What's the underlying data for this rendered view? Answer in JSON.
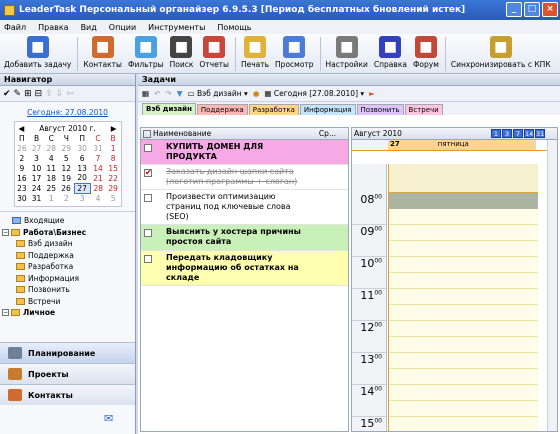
{
  "window": {
    "title": "LeaderTask Персональный органайзер 6.9.5.3 [Период бесплатных  бновлений истек]"
  },
  "menu": [
    "Файл",
    "Правка",
    "Вид",
    "Опции",
    "Инструменты",
    "Помощь"
  ],
  "toolbar": [
    {
      "label": "Добавить задачу",
      "icon": "add-task-icon",
      "color": "#3a6fd0"
    },
    {
      "label": "Контакты",
      "icon": "contacts-icon",
      "color": "#d06a30"
    },
    {
      "label": "Фильтры",
      "icon": "filter-icon",
      "color": "#4aa0e0"
    },
    {
      "label": "Поиск",
      "icon": "binoculars-icon",
      "color": "#444444"
    },
    {
      "label": "Отчеты",
      "icon": "reports-icon",
      "color": "#c9463d"
    },
    {
      "label": "Печать",
      "icon": "printer-icon",
      "color": "#e0b23a"
    },
    {
      "label": "Просмотр",
      "icon": "preview-icon",
      "color": "#4c7cd8"
    },
    {
      "label": "Настройки",
      "icon": "gear-icon",
      "color": "#7a7a7a"
    },
    {
      "label": "Справка",
      "icon": "help-icon",
      "color": "#3340c0"
    },
    {
      "label": "Форум",
      "icon": "forum-icon",
      "color": "#c04a3a"
    },
    {
      "label": "Синхронизировать с КПК",
      "icon": "sync-icon",
      "color": "#c5a030"
    }
  ],
  "navigator": {
    "title": "Навигатор",
    "today_link": "Сегодня: 27.08.2010",
    "calendar": {
      "month": "Август 2010 г.",
      "weekdays": [
        "П",
        "В",
        "С",
        "Ч",
        "П",
        "С",
        "В"
      ],
      "weeks": [
        [
          "26",
          "27",
          "28",
          "29",
          "30",
          "31",
          "1"
        ],
        [
          "2",
          "3",
          "4",
          "5",
          "6",
          "7",
          "8"
        ],
        [
          "9",
          "10",
          "11",
          "12",
          "13",
          "14",
          "15"
        ],
        [
          "16",
          "17",
          "18",
          "19",
          "20",
          "21",
          "22"
        ],
        [
          "23",
          "24",
          "25",
          "26",
          "27",
          "28",
          "29"
        ],
        [
          "30",
          "31",
          "1",
          "2",
          "3",
          "4",
          "5"
        ]
      ]
    },
    "tree": [
      {
        "label": "Входящие",
        "level": 1
      },
      {
        "label": "Работа\\Бизнес",
        "level": 0,
        "bold": true
      },
      {
        "label": "Вэб дизайн",
        "level": 2
      },
      {
        "label": "Поддержка",
        "level": 2
      },
      {
        "label": "Разработка",
        "level": 2
      },
      {
        "label": "Информация",
        "level": 2
      },
      {
        "label": "Позвонить",
        "level": 2
      },
      {
        "label": "Встречи",
        "level": 2
      },
      {
        "label": "Личное",
        "level": 0,
        "bold": true
      }
    ],
    "buttons": [
      {
        "label": "Планирование",
        "color": "#6f7f98"
      },
      {
        "label": "Проекты",
        "color": "#c77b2e"
      },
      {
        "label": "Контакты",
        "color": "#d06a30"
      }
    ]
  },
  "tasks_pane": {
    "title": "Задачи",
    "toolbar": {
      "category": "Вэб дизайн",
      "date": "Сегодня [27.08.2010]"
    },
    "tabs": [
      {
        "label": "Вэб дизайн",
        "color": "#d6f0c8"
      },
      {
        "label": "Поддержка",
        "color": "#ffb8b8"
      },
      {
        "label": "Разработка",
        "color": "#ffd58c"
      },
      {
        "label": "Информация",
        "color": "#c4e4ff"
      },
      {
        "label": "Позвонить",
        "color": "#dcc4ff"
      },
      {
        "label": "Встречи",
        "color": "#ffc4e0"
      }
    ],
    "list": {
      "header_name": "Наименование",
      "header_extra": "Ср...",
      "tasks": [
        {
          "text": "КУПИТЬ ДОМЕН ДЛЯ ПРОДУКТА",
          "bg": "#f7a9e6",
          "bold": true,
          "done": false,
          "height": 22
        },
        {
          "text": "Заказать дизайн шапки сайта (логотип программы + слоган)",
          "bg": "#ffffff",
          "bold": false,
          "done": true,
          "height": 24
        },
        {
          "text": "Произвести оптимизацию страниц под ключевые слова (SEO)",
          "bg": "#ffffff",
          "bold": false,
          "done": false,
          "height": 32
        },
        {
          "text": "Выяснить у хостера причины простоя сайта",
          "bg": "#c8f0b8",
          "bold": true,
          "done": false,
          "height": 26
        },
        {
          "text": "Передать кладовщику информацию об остатках на складе",
          "bg": "#ffffb0",
          "bold": true,
          "done": false,
          "height": 32
        }
      ]
    },
    "calendar": {
      "month": "Август 2010",
      "view_buttons": [
        "1",
        "3",
        "7",
        "14",
        "31"
      ],
      "day_number": "27",
      "day_name": "пятница",
      "hours": [
        "08",
        "09",
        "10",
        "11",
        "12",
        "13",
        "14",
        "15"
      ]
    }
  }
}
